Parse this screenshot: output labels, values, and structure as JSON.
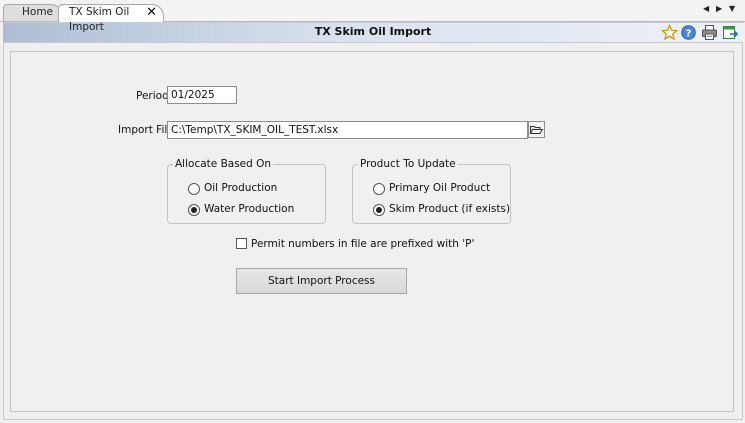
{
  "tabs": [
    {
      "label": "Home"
    },
    {
      "label": "TX Skim Oil Import"
    }
  ],
  "icons": {
    "tab_close": "close-icon",
    "scroll_left": "arrow-left-icon",
    "scroll_right": "arrow-right-icon",
    "tab_menu": "dropdown-icon",
    "favorite": "star-icon",
    "help": "help-icon",
    "print": "printer-icon",
    "export": "export-icon",
    "browse": "folder-open-icon"
  },
  "header": {
    "title": "TX Skim Oil Import"
  },
  "form": {
    "period_label": "Period",
    "period_value": "01/2025",
    "import_file_label": "Import File",
    "import_file_value": "C:\\Temp\\TX_SKIM_OIL_TEST.xlsx",
    "allocate": {
      "legend": "Allocate Based On",
      "options": [
        {
          "label": "Oil Production",
          "checked": false
        },
        {
          "label": "Water Production",
          "checked": true
        }
      ]
    },
    "product": {
      "legend": "Product To Update",
      "options": [
        {
          "label": "Primary Oil Product",
          "checked": false
        },
        {
          "label": "Skim Product (if exists)",
          "checked": true
        }
      ]
    },
    "permit_checkbox_label": "Permit numbers in file are prefixed with 'P'",
    "permit_checked": false,
    "start_button": "Start Import Process"
  },
  "colors": {
    "titlebar_start": "#aebdd4",
    "titlebar_end": "#eef2f8",
    "background": "#f0f0f0"
  }
}
